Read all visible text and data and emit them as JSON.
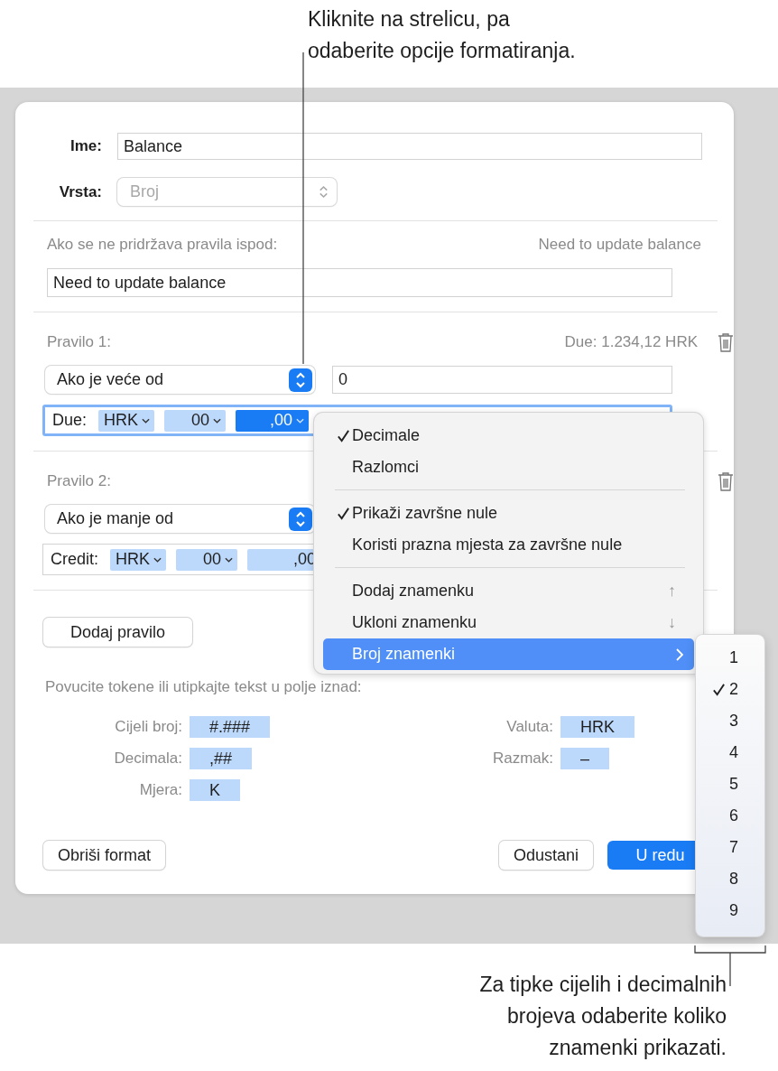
{
  "callout_top": {
    "lines": [
      "Kliknite na strelicu, pa",
      "odaberite opcije formatiranja."
    ]
  },
  "dialog": {
    "name": {
      "label": "Ime:",
      "value": "Balance"
    },
    "type": {
      "label": "Vrsta:",
      "value": "Broj",
      "disabled": true
    },
    "fallback": {
      "label": "Ako se ne pridržava pravila ispod:",
      "preview": "Need to update balance",
      "value": "Need to update balance"
    },
    "rules": [
      {
        "title": "Pravilo 1:",
        "preview": "Due: 1.234,12 HRK",
        "condition": "Ako je veće od",
        "value": "0",
        "format_label": "Due:",
        "focused": true,
        "tokens": [
          {
            "text": "HRK",
            "selected": false,
            "dropdown": true
          },
          {
            "text": "00",
            "selected": false,
            "dropdown": true
          },
          {
            "text": ",00",
            "selected": true,
            "dropdown": true
          }
        ]
      },
      {
        "title": "Pravilo 2:",
        "condition": "Ako je manje od",
        "format_label": "Credit:",
        "focused": false,
        "tokens": [
          {
            "text": "HRK",
            "selected": false,
            "dropdown": true
          },
          {
            "text": "00",
            "selected": false,
            "dropdown": true
          },
          {
            "text": ",00",
            "selected": false,
            "dropdown": false
          }
        ]
      }
    ],
    "add_rule_button": "Dodaj pravilo",
    "hint": "Povucite tokene ili utipkajte tekst u polje iznad:",
    "palette_left": [
      {
        "label": "Cijeli broj:",
        "token": "#.###"
      },
      {
        "label": "Decimala:",
        "token": ",##"
      },
      {
        "label": "Mjera:",
        "token": "K"
      }
    ],
    "palette_right": [
      {
        "label": "Valuta:",
        "token": "HRK"
      },
      {
        "label": "Razmak:",
        "token": "–"
      }
    ],
    "buttons": {
      "clear": "Obriši format",
      "cancel": "Odustani",
      "ok": "U redu"
    }
  },
  "menu": {
    "items": [
      {
        "kind": "item",
        "label": "Decimale",
        "checked": true
      },
      {
        "kind": "item",
        "label": "Razlomci",
        "checked": false
      },
      {
        "kind": "separator"
      },
      {
        "kind": "item",
        "label": "Prikaži završne nule",
        "checked": true
      },
      {
        "kind": "item",
        "label": "Koristi prazna mjesta za završne nule",
        "checked": false
      },
      {
        "kind": "separator"
      },
      {
        "kind": "item",
        "label": "Dodaj znamenku",
        "checked": false,
        "shortcut": "↑"
      },
      {
        "kind": "item",
        "label": "Ukloni znamenku",
        "checked": false,
        "shortcut": "↓"
      },
      {
        "kind": "submenu",
        "label": "Broj znamenki",
        "selected": true
      }
    ]
  },
  "submenu": {
    "items": [
      {
        "label": "1",
        "checked": false
      },
      {
        "label": "2",
        "checked": true
      },
      {
        "label": "3",
        "checked": false
      },
      {
        "label": "4",
        "checked": false
      },
      {
        "label": "5",
        "checked": false
      },
      {
        "label": "6",
        "checked": false
      },
      {
        "label": "7",
        "checked": false
      },
      {
        "label": "8",
        "checked": false
      },
      {
        "label": "9",
        "checked": false
      }
    ]
  },
  "callout_bottom": {
    "lines": [
      "Za tipke cijelih i decimalnih",
      "brojeva odaberite koliko",
      "znamenki prikazati."
    ]
  }
}
